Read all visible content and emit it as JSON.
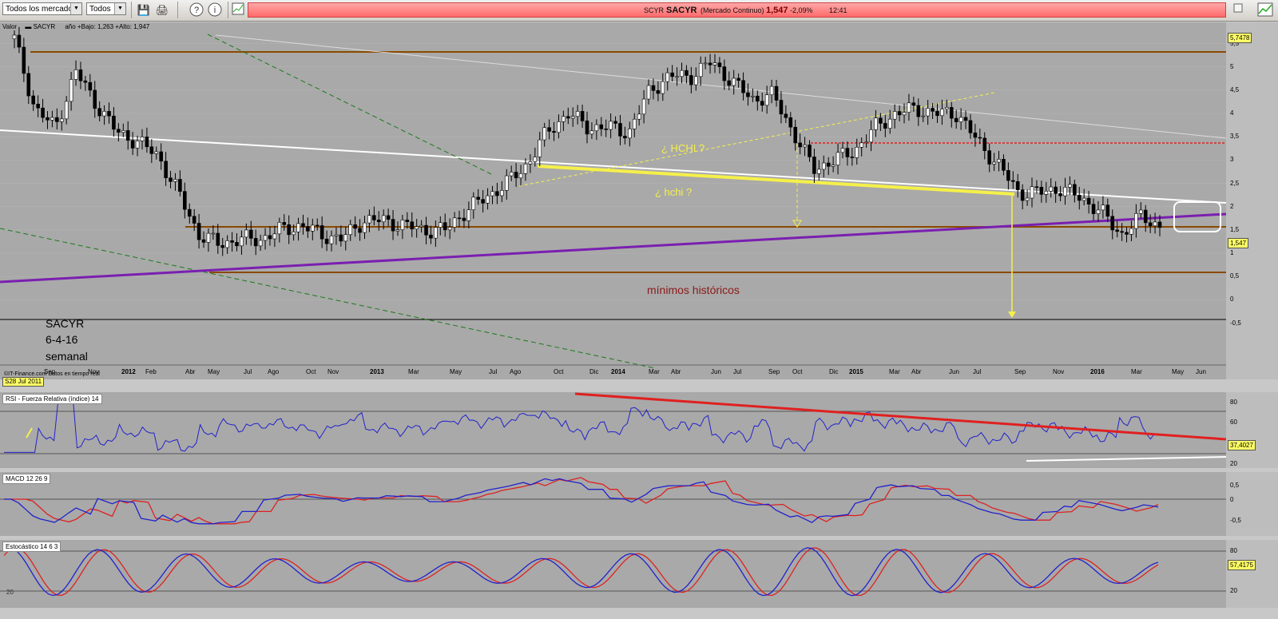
{
  "toolbar": {
    "market_select": "Todos los mercados",
    "filter_select": "Todos"
  },
  "quote": {
    "code": "SCYR",
    "name": "SACYR",
    "market": "(Mercado Continuo)",
    "price": "1,547",
    "change": "-2,09%",
    "time": "12:41"
  },
  "main_panel": {
    "label_valor": "Valor",
    "label_symbol": "SACYR",
    "label_range": "año +Bajo: 1,263 +Alto: 1,947",
    "credit": "©IT-Finance.com  Datos en tiempo real",
    "date_tag": "S28 Jul 2011",
    "annotations": {
      "hchi_upper": "¿ HCHI ?",
      "hchi_lower": "¿ hchi ?",
      "minimos": "mínimos históricos",
      "note_line1": "SACYR",
      "note_line2": "6-4-16",
      "note_line3": "semanal"
    },
    "top_value": "5,7478",
    "last_price": "1,547",
    "y_ticks": [
      "5,5",
      "5",
      "4,5",
      "4",
      "3,5",
      "3",
      "2,5",
      "2",
      "1,5",
      "1",
      "0,5",
      "0",
      "-0,5"
    ],
    "x_ticks": [
      "Sep",
      "Nov",
      "2012",
      "Feb",
      "Abr",
      "May",
      "Jul",
      "Ago",
      "Oct",
      "Nov",
      "2013",
      "Mar",
      "May",
      "Jul",
      "Ago",
      "Oct",
      "Dic",
      "2014",
      "Mar",
      "Abr",
      "Jun",
      "Jul",
      "Sep",
      "Oct",
      "Dic",
      "2015",
      "Mar",
      "Abr",
      "Jun",
      "Jul",
      "Sep",
      "Nov",
      "2016",
      "Mar",
      "May",
      "Jun"
    ]
  },
  "rsi_panel": {
    "label": "RSI - Fuerza Relativa (índice) 14",
    "value": "37,4027",
    "ticks": [
      "80",
      "60",
      "40",
      "20"
    ]
  },
  "macd_panel": {
    "label": "MACD 12 26 9",
    "ticks": [
      "0,5",
      "0",
      "-0,5"
    ]
  },
  "stoch_panel": {
    "label": "Estocástico 14 6 3",
    "value": "57,4175",
    "ticks": [
      "80",
      "20"
    ],
    "left_tick": "20"
  },
  "colors": {
    "candle_up": "#ffffff",
    "candle_down": "#000000",
    "orange_line": "#8b4a00",
    "purple_line": "#7a1fb0",
    "yellow_line": "#f5f04a",
    "rsi_line": "#2222cc",
    "signal_line": "#dd2222",
    "annotation_red": "#8b1a1a"
  },
  "chart_data": {
    "type": "line",
    "title": "SACYR",
    "ylim": [
      -0.9,
      5.8
    ],
    "x": [
      "2011-08",
      "2011-09",
      "2011-10",
      "2011-11",
      "2011-12",
      "2012-01",
      "2012-02",
      "2012-03",
      "2012-04",
      "2012-05",
      "2012-06",
      "2012-07",
      "2012-08",
      "2012-09",
      "2012-10",
      "2012-11",
      "2012-12",
      "2013-01",
      "2013-02",
      "2013-03",
      "2013-04",
      "2013-05",
      "2013-06",
      "2013-07",
      "2013-08",
      "2013-09",
      "2013-10",
      "2013-11",
      "2013-12",
      "2014-01",
      "2014-02",
      "2014-03",
      "2014-04",
      "2014-05",
      "2014-06",
      "2014-07",
      "2014-08",
      "2014-09",
      "2014-10",
      "2014-11",
      "2014-12",
      "2015-01",
      "2015-02",
      "2015-03",
      "2015-04",
      "2015-05",
      "2015-06",
      "2015-07",
      "2015-08",
      "2015-09",
      "2015-10",
      "2015-11",
      "2015-12",
      "2016-01",
      "2016-02",
      "2016-03",
      "2016-04"
    ],
    "series": [
      {
        "name": "SACYR",
        "values": [
          5.6,
          4.1,
          3.7,
          4.9,
          4.2,
          3.6,
          3.4,
          3.1,
          2.3,
          1.4,
          1.2,
          1.3,
          1.3,
          1.5,
          1.6,
          1.4,
          1.3,
          1.7,
          1.7,
          1.6,
          1.5,
          1.5,
          1.9,
          2.2,
          2.5,
          2.9,
          3.6,
          4.0,
          3.7,
          3.7,
          3.6,
          4.5,
          4.8,
          4.8,
          5.1,
          4.7,
          4.3,
          4.4,
          3.6,
          2.8,
          3.0,
          3.2,
          3.7,
          4.0,
          4.1,
          4.0,
          4.0,
          3.4,
          2.9,
          2.3,
          2.3,
          2.4,
          2.2,
          1.9,
          1.4,
          1.8,
          1.55
        ]
      }
    ]
  }
}
